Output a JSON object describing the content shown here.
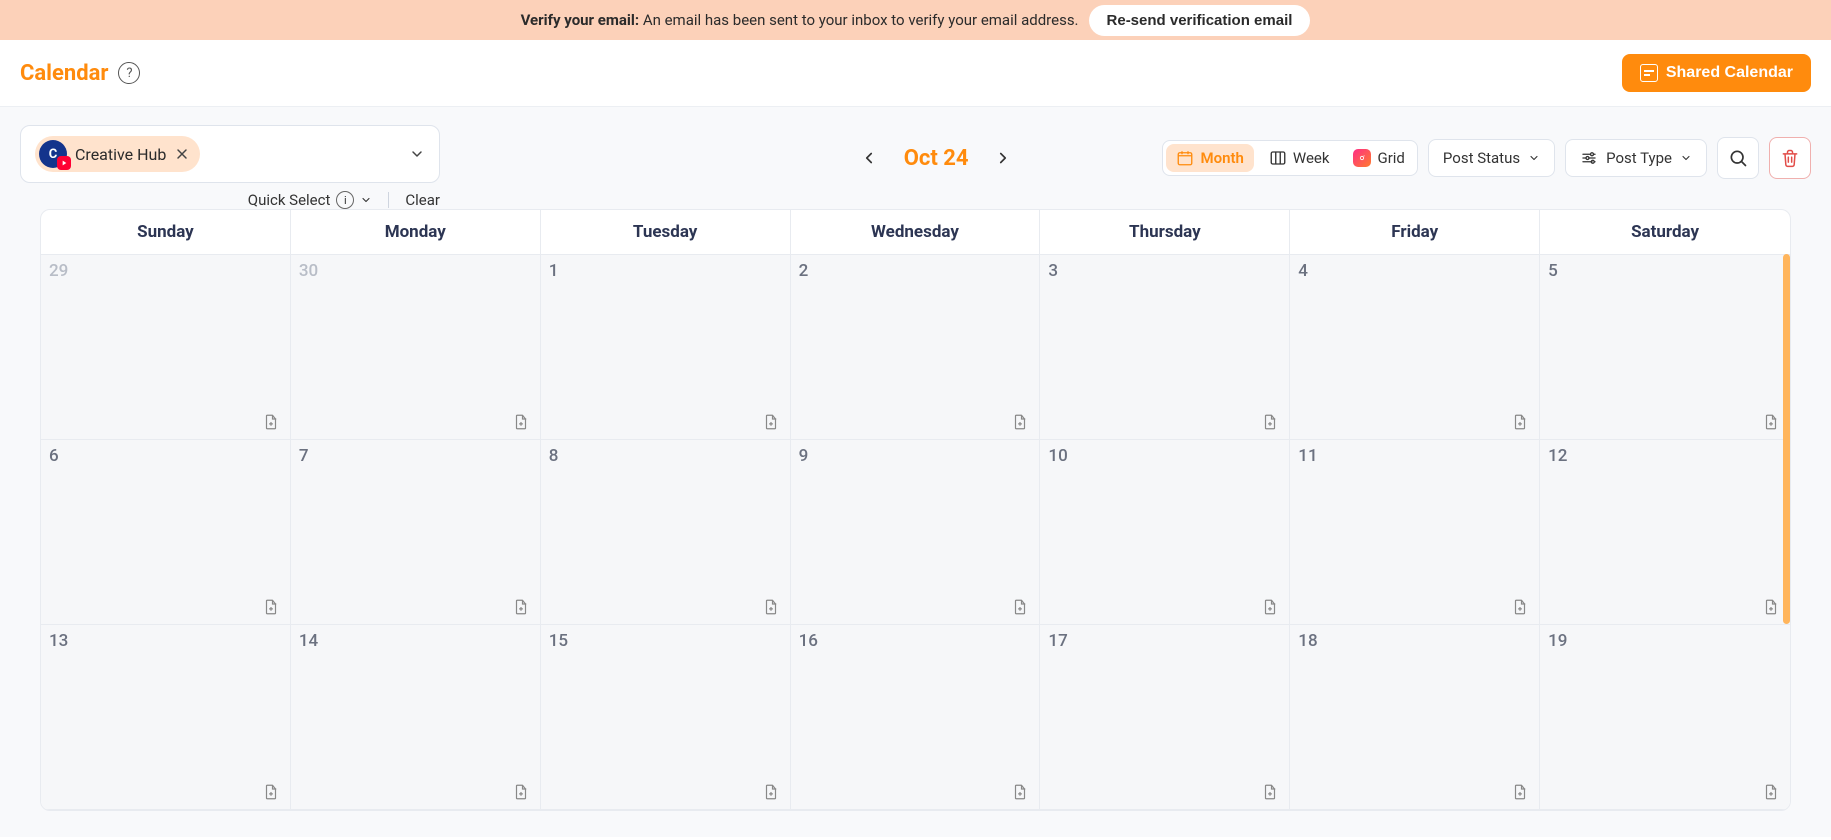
{
  "banner": {
    "prefix": "Verify your email:",
    "message": "An email has been sent to your inbox to verify your email address.",
    "button": "Re-send verification email"
  },
  "header": {
    "title": "Calendar",
    "shared_button": "Shared Calendar"
  },
  "profile_selector": {
    "chip_initial": "C",
    "chip_label": "Creative Hub",
    "quick_select": "Quick Select",
    "clear": "Clear"
  },
  "date_nav": {
    "label": "Oct 24"
  },
  "views": {
    "month": "Month",
    "week": "Week",
    "grid": "Grid"
  },
  "filters": {
    "post_status": "Post Status",
    "post_type": "Post Type"
  },
  "calendar": {
    "weekdays": [
      "Sunday",
      "Monday",
      "Tuesday",
      "Wednesday",
      "Thursday",
      "Friday",
      "Saturday"
    ],
    "cells": [
      {
        "n": "29",
        "other": true
      },
      {
        "n": "30",
        "other": true
      },
      {
        "n": "1"
      },
      {
        "n": "2"
      },
      {
        "n": "3"
      },
      {
        "n": "4"
      },
      {
        "n": "5"
      },
      {
        "n": "6"
      },
      {
        "n": "7"
      },
      {
        "n": "8"
      },
      {
        "n": "9"
      },
      {
        "n": "10"
      },
      {
        "n": "11"
      },
      {
        "n": "12"
      },
      {
        "n": "13"
      },
      {
        "n": "14"
      },
      {
        "n": "15"
      },
      {
        "n": "16"
      },
      {
        "n": "17"
      },
      {
        "n": "18"
      },
      {
        "n": "19"
      }
    ]
  }
}
